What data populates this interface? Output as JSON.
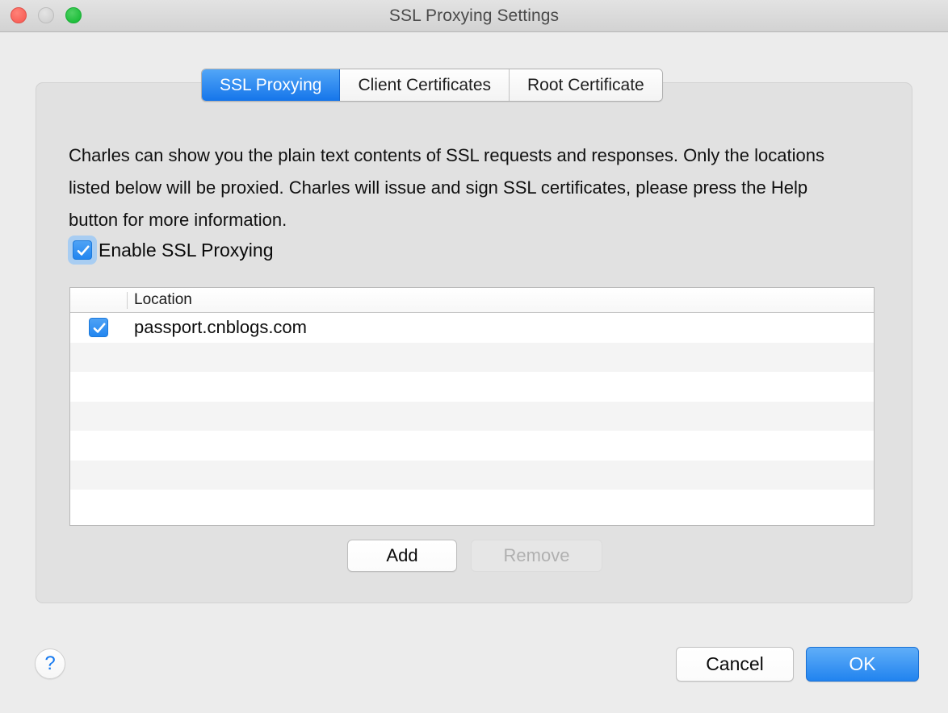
{
  "window": {
    "title": "SSL Proxying Settings",
    "controls": {
      "close": "close-button",
      "minimize": "minimize-button",
      "maximize": "maximize-button"
    }
  },
  "tabs": [
    {
      "label": "SSL Proxying",
      "active": true
    },
    {
      "label": "Client Certificates",
      "active": false
    },
    {
      "label": "Root Certificate",
      "active": false
    }
  ],
  "panel": {
    "description": "Charles can show you the plain text contents of SSL requests and responses. Only the locations listed below will be proxied. Charles will issue and sign SSL certificates, please press the Help button for more information.",
    "enable_checkbox": {
      "label": "Enable SSL Proxying",
      "checked": true,
      "focused": true
    },
    "table": {
      "columns": [
        "",
        "Location"
      ],
      "rows": [
        {
          "checked": true,
          "location": "passport.cnblogs.com"
        }
      ],
      "empty_row_count": 6
    },
    "list_buttons": {
      "add_label": "Add",
      "remove_label": "Remove",
      "remove_disabled": true
    }
  },
  "footer": {
    "help_label": "?",
    "cancel_label": "Cancel",
    "ok_label": "OK"
  },
  "colors": {
    "accent": "#2286f0",
    "window_bg": "#ececec",
    "panel_bg": "#e1e1e1",
    "help_glyph": "#1579f0"
  }
}
